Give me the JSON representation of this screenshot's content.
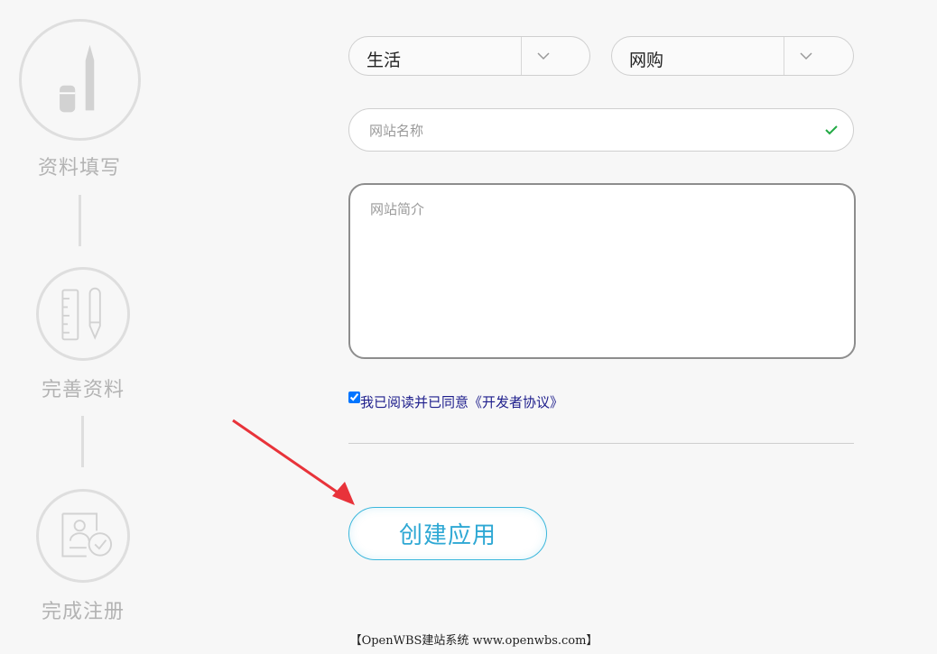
{
  "steps": [
    {
      "label": "资料填写",
      "icon": "pen-icon"
    },
    {
      "label": "完善资料",
      "icon": "ruler-pen-icon"
    },
    {
      "label": "完成注册",
      "icon": "id-card-check-icon"
    }
  ],
  "form": {
    "category_primary": "生活",
    "category_secondary": "网购",
    "site_name_placeholder": "网站名称",
    "site_intro_placeholder": "网站简介",
    "agree_text": "我已阅读并已同意《开发者协议》",
    "agree_checked": true,
    "submit_label": "创建应用"
  },
  "footer": {
    "text": "【OpenWBS建站系统 www.openwbs.com】"
  },
  "colors": {
    "accent": "#3bb7dc",
    "success": "#22aa44",
    "annotation_arrow": "#e8333a",
    "link": "#1e1e8c"
  }
}
